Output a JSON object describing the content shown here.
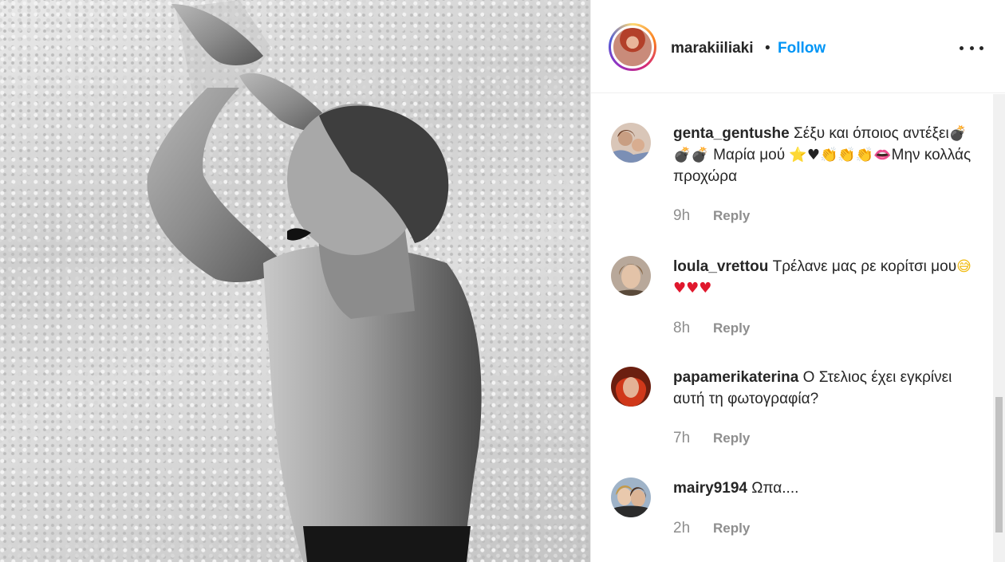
{
  "post": {
    "username": "marakiiliaki",
    "separator": "•",
    "follow_label": "Follow"
  },
  "comments": [
    {
      "username": "genta_gentushe",
      "text_1": "Σέξυ και όποιος αντέξει",
      "emoji_1": "💣💣💣",
      "text_2": " Μαρία μού ",
      "emoji_2": "⭐",
      "emoji_3": "♥",
      "emoji_4": "👏👏👏",
      "emoji_5": "👄",
      "text_3": "Μην κολλάς προχώρα",
      "time": "9h",
      "reply": "Reply"
    },
    {
      "username": "loula_vrettou",
      "text_1": "Τρέλανε μας ρε κορίτσι μου",
      "emoji_1": "😅",
      "emoji_2": "♥♥♥",
      "time": "8h",
      "reply": "Reply"
    },
    {
      "username": "papamerikaterina",
      "text_1": "Ο Στελιος έχει εγκρίνει αυτή τη φωτογραφία?",
      "time": "7h",
      "reply": "Reply"
    },
    {
      "username": "mairy9194",
      "text_1": "Ωπα....",
      "time": "2h",
      "reply": "Reply"
    }
  ],
  "colors": {
    "follow": "#0095f6",
    "meta": "#8e8e8e",
    "text": "#262626"
  }
}
